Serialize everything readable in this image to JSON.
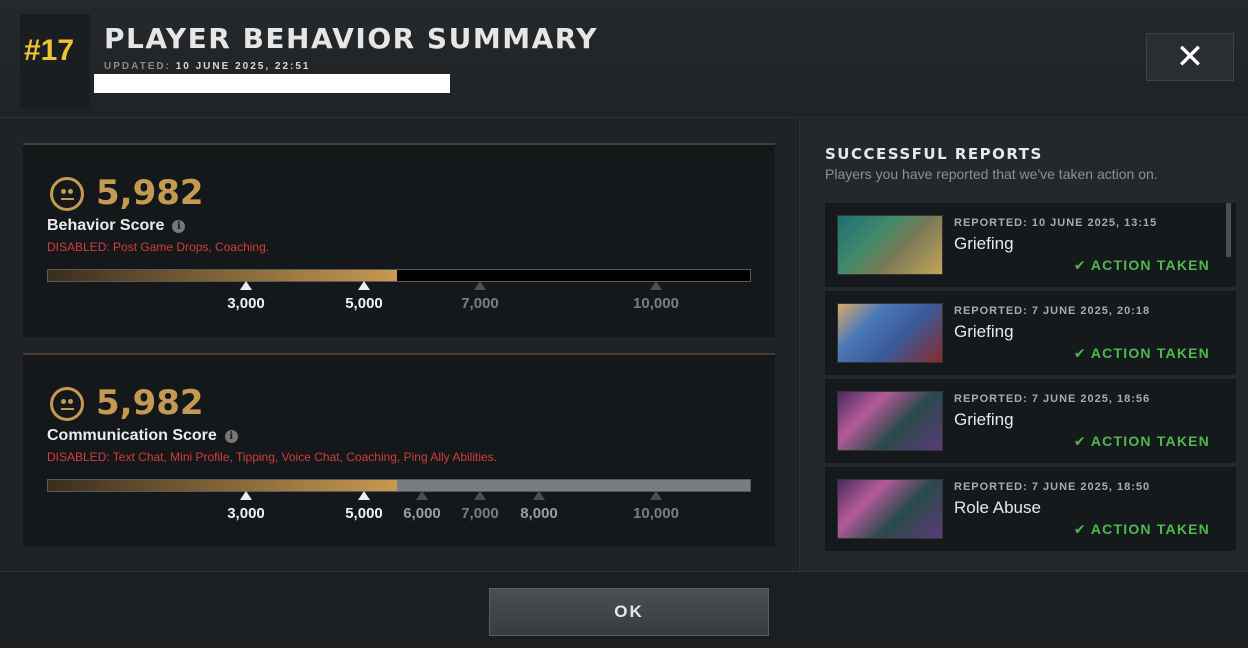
{
  "header": {
    "rank": "#17",
    "title": "PLAYER BEHAVIOR SUMMARY",
    "updated_label": "UPDATED:",
    "updated_value": "10 JUNE 2025, 22:51",
    "close_label": "✕"
  },
  "behavior": {
    "score": "5,982",
    "label": "Behavior Score",
    "disabled": "DISABLED:  Post Game Drops, Coaching.",
    "fill_fraction": 0.497,
    "ticks": [
      {
        "label": "3,000",
        "active": true
      },
      {
        "label": "5,000",
        "active": true
      },
      {
        "label": "7,000",
        "active": false
      },
      {
        "label": "10,000",
        "active": false
      }
    ]
  },
  "communication": {
    "score": "5,982",
    "label": "Communication Score",
    "disabled": "DISABLED:  Text Chat, Mini Profile, Tipping, Voice Chat, Coaching, Ping Ally Abilities.",
    "fill_fraction": 0.497,
    "ticks": [
      {
        "label": "3,000",
        "active": true
      },
      {
        "label": "5,000",
        "active": true
      },
      {
        "label": "6,000",
        "active": false
      },
      {
        "label": "7,000",
        "active": false
      },
      {
        "label": "8,000",
        "active": false
      },
      {
        "label": "10,000",
        "active": false
      }
    ]
  },
  "reports_panel": {
    "title": "SUCCESSFUL REPORTS",
    "subtitle": "Players you have reported that we've taken action on.",
    "items": [
      {
        "reported": "REPORTED: 10 JUNE 2025, 13:15",
        "reason": "Griefing",
        "status": "ACTION TAKEN"
      },
      {
        "reported": "REPORTED: 7 JUNE 2025, 20:18",
        "reason": "Griefing",
        "status": "ACTION TAKEN"
      },
      {
        "reported": "REPORTED: 7 JUNE 2025, 18:56",
        "reason": "Griefing",
        "status": "ACTION TAKEN"
      },
      {
        "reported": "REPORTED: 7 JUNE 2025, 18:50",
        "reason": "Role Abuse",
        "status": "ACTION TAKEN"
      }
    ]
  },
  "footer": {
    "ok_label": "OK"
  },
  "colors": {
    "accent_gold": "#c49a52",
    "rank_yellow": "#f1c232",
    "disabled_red": "#d33c3c",
    "action_green": "#4fb84f"
  }
}
